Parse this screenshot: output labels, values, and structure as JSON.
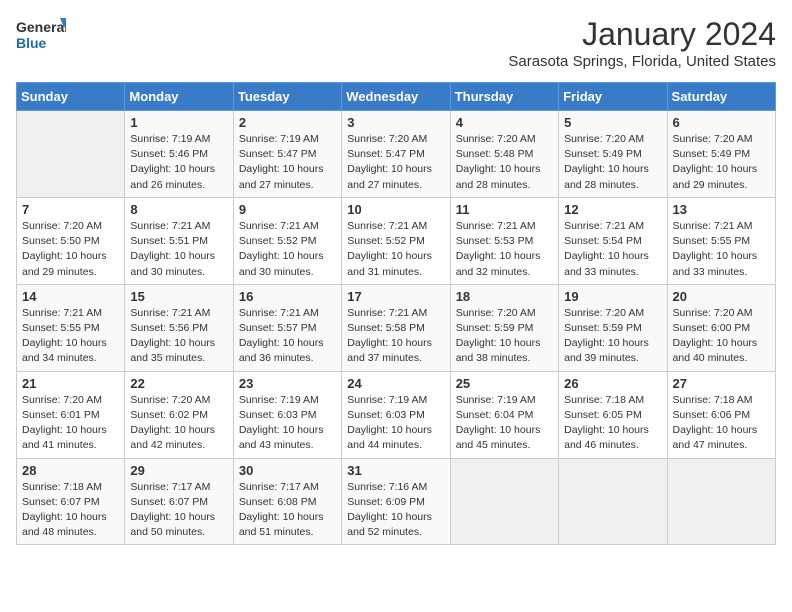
{
  "header": {
    "logo_line1": "General",
    "logo_line2": "Blue",
    "title": "January 2024",
    "subtitle": "Sarasota Springs, Florida, United States"
  },
  "weekdays": [
    "Sunday",
    "Monday",
    "Tuesday",
    "Wednesday",
    "Thursday",
    "Friday",
    "Saturday"
  ],
  "weeks": [
    [
      {
        "num": "",
        "sunrise": "",
        "sunset": "",
        "daylight": ""
      },
      {
        "num": "1",
        "sunrise": "Sunrise: 7:19 AM",
        "sunset": "Sunset: 5:46 PM",
        "daylight": "Daylight: 10 hours and 26 minutes."
      },
      {
        "num": "2",
        "sunrise": "Sunrise: 7:19 AM",
        "sunset": "Sunset: 5:47 PM",
        "daylight": "Daylight: 10 hours and 27 minutes."
      },
      {
        "num": "3",
        "sunrise": "Sunrise: 7:20 AM",
        "sunset": "Sunset: 5:47 PM",
        "daylight": "Daylight: 10 hours and 27 minutes."
      },
      {
        "num": "4",
        "sunrise": "Sunrise: 7:20 AM",
        "sunset": "Sunset: 5:48 PM",
        "daylight": "Daylight: 10 hours and 28 minutes."
      },
      {
        "num": "5",
        "sunrise": "Sunrise: 7:20 AM",
        "sunset": "Sunset: 5:49 PM",
        "daylight": "Daylight: 10 hours and 28 minutes."
      },
      {
        "num": "6",
        "sunrise": "Sunrise: 7:20 AM",
        "sunset": "Sunset: 5:49 PM",
        "daylight": "Daylight: 10 hours and 29 minutes."
      }
    ],
    [
      {
        "num": "7",
        "sunrise": "Sunrise: 7:20 AM",
        "sunset": "Sunset: 5:50 PM",
        "daylight": "Daylight: 10 hours and 29 minutes."
      },
      {
        "num": "8",
        "sunrise": "Sunrise: 7:21 AM",
        "sunset": "Sunset: 5:51 PM",
        "daylight": "Daylight: 10 hours and 30 minutes."
      },
      {
        "num": "9",
        "sunrise": "Sunrise: 7:21 AM",
        "sunset": "Sunset: 5:52 PM",
        "daylight": "Daylight: 10 hours and 30 minutes."
      },
      {
        "num": "10",
        "sunrise": "Sunrise: 7:21 AM",
        "sunset": "Sunset: 5:52 PM",
        "daylight": "Daylight: 10 hours and 31 minutes."
      },
      {
        "num": "11",
        "sunrise": "Sunrise: 7:21 AM",
        "sunset": "Sunset: 5:53 PM",
        "daylight": "Daylight: 10 hours and 32 minutes."
      },
      {
        "num": "12",
        "sunrise": "Sunrise: 7:21 AM",
        "sunset": "Sunset: 5:54 PM",
        "daylight": "Daylight: 10 hours and 33 minutes."
      },
      {
        "num": "13",
        "sunrise": "Sunrise: 7:21 AM",
        "sunset": "Sunset: 5:55 PM",
        "daylight": "Daylight: 10 hours and 33 minutes."
      }
    ],
    [
      {
        "num": "14",
        "sunrise": "Sunrise: 7:21 AM",
        "sunset": "Sunset: 5:55 PM",
        "daylight": "Daylight: 10 hours and 34 minutes."
      },
      {
        "num": "15",
        "sunrise": "Sunrise: 7:21 AM",
        "sunset": "Sunset: 5:56 PM",
        "daylight": "Daylight: 10 hours and 35 minutes."
      },
      {
        "num": "16",
        "sunrise": "Sunrise: 7:21 AM",
        "sunset": "Sunset: 5:57 PM",
        "daylight": "Daylight: 10 hours and 36 minutes."
      },
      {
        "num": "17",
        "sunrise": "Sunrise: 7:21 AM",
        "sunset": "Sunset: 5:58 PM",
        "daylight": "Daylight: 10 hours and 37 minutes."
      },
      {
        "num": "18",
        "sunrise": "Sunrise: 7:20 AM",
        "sunset": "Sunset: 5:59 PM",
        "daylight": "Daylight: 10 hours and 38 minutes."
      },
      {
        "num": "19",
        "sunrise": "Sunrise: 7:20 AM",
        "sunset": "Sunset: 5:59 PM",
        "daylight": "Daylight: 10 hours and 39 minutes."
      },
      {
        "num": "20",
        "sunrise": "Sunrise: 7:20 AM",
        "sunset": "Sunset: 6:00 PM",
        "daylight": "Daylight: 10 hours and 40 minutes."
      }
    ],
    [
      {
        "num": "21",
        "sunrise": "Sunrise: 7:20 AM",
        "sunset": "Sunset: 6:01 PM",
        "daylight": "Daylight: 10 hours and 41 minutes."
      },
      {
        "num": "22",
        "sunrise": "Sunrise: 7:20 AM",
        "sunset": "Sunset: 6:02 PM",
        "daylight": "Daylight: 10 hours and 42 minutes."
      },
      {
        "num": "23",
        "sunrise": "Sunrise: 7:19 AM",
        "sunset": "Sunset: 6:03 PM",
        "daylight": "Daylight: 10 hours and 43 minutes."
      },
      {
        "num": "24",
        "sunrise": "Sunrise: 7:19 AM",
        "sunset": "Sunset: 6:03 PM",
        "daylight": "Daylight: 10 hours and 44 minutes."
      },
      {
        "num": "25",
        "sunrise": "Sunrise: 7:19 AM",
        "sunset": "Sunset: 6:04 PM",
        "daylight": "Daylight: 10 hours and 45 minutes."
      },
      {
        "num": "26",
        "sunrise": "Sunrise: 7:18 AM",
        "sunset": "Sunset: 6:05 PM",
        "daylight": "Daylight: 10 hours and 46 minutes."
      },
      {
        "num": "27",
        "sunrise": "Sunrise: 7:18 AM",
        "sunset": "Sunset: 6:06 PM",
        "daylight": "Daylight: 10 hours and 47 minutes."
      }
    ],
    [
      {
        "num": "28",
        "sunrise": "Sunrise: 7:18 AM",
        "sunset": "Sunset: 6:07 PM",
        "daylight": "Daylight: 10 hours and 48 minutes."
      },
      {
        "num": "29",
        "sunrise": "Sunrise: 7:17 AM",
        "sunset": "Sunset: 6:07 PM",
        "daylight": "Daylight: 10 hours and 50 minutes."
      },
      {
        "num": "30",
        "sunrise": "Sunrise: 7:17 AM",
        "sunset": "Sunset: 6:08 PM",
        "daylight": "Daylight: 10 hours and 51 minutes."
      },
      {
        "num": "31",
        "sunrise": "Sunrise: 7:16 AM",
        "sunset": "Sunset: 6:09 PM",
        "daylight": "Daylight: 10 hours and 52 minutes."
      },
      {
        "num": "",
        "sunrise": "",
        "sunset": "",
        "daylight": ""
      },
      {
        "num": "",
        "sunrise": "",
        "sunset": "",
        "daylight": ""
      },
      {
        "num": "",
        "sunrise": "",
        "sunset": "",
        "daylight": ""
      }
    ]
  ]
}
